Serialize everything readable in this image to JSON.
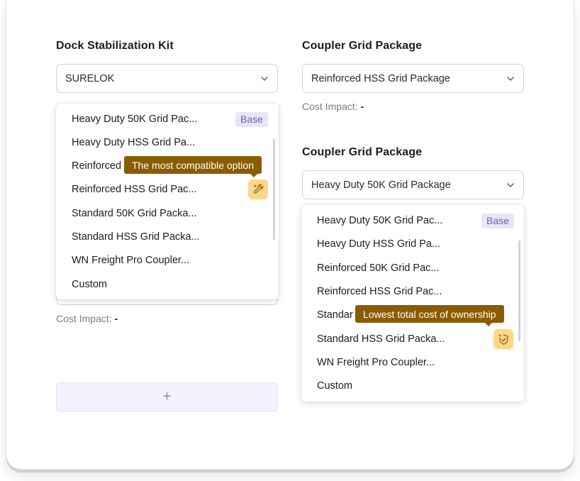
{
  "left_section": {
    "title": "Dock Stabilization Kit",
    "select_value": "SURELOK",
    "cost_label": "Cost Impact:",
    "cost_value": "-",
    "menu_items": [
      "Heavy Duty 50K Grid Pac...",
      "Heavy Duty HSS Grid Pa...",
      "Reinforced",
      "Reinforced HSS Grid Pac...",
      "Standard 50K Grid Packa...",
      "Standard HSS Grid Packa...",
      "WN Freight Pro Coupler...",
      "Custom"
    ],
    "base_badge": "Base",
    "tooltip": "The most compatible option",
    "highlight_icon": "wrench-sparkle-icon",
    "add_button_label": "+"
  },
  "right_top_section": {
    "title": "Coupler Grid Package",
    "select_value": "Reinforced HSS Grid Package",
    "cost_label": "Cost Impact:",
    "cost_value": "-"
  },
  "right_bottom_section": {
    "title": "Coupler Grid Package",
    "select_value": "Heavy Duty 50K Grid Package",
    "menu_items": [
      "Heavy Duty 50K Grid Pac...",
      "Heavy Duty HSS Grid Pa...",
      "Reinforced 50K Grid Pac...",
      "Reinforced HSS Grid Pac...",
      "Standar",
      "Standard HSS Grid Packa...",
      "WN Freight Pro Coupler...",
      "Custom"
    ],
    "base_badge": "Base",
    "tooltip": "Lowest total cost of ownership",
    "highlight_icon": "shield-sparkle-icon"
  },
  "colors": {
    "tooltip_bg": "#8a5c00",
    "icon_chip_bg": "#fdd68c",
    "base_badge_bg": "#e7e5f6",
    "base_badge_text": "#6b66a8",
    "add_button_bg": "#f4f3fd"
  }
}
